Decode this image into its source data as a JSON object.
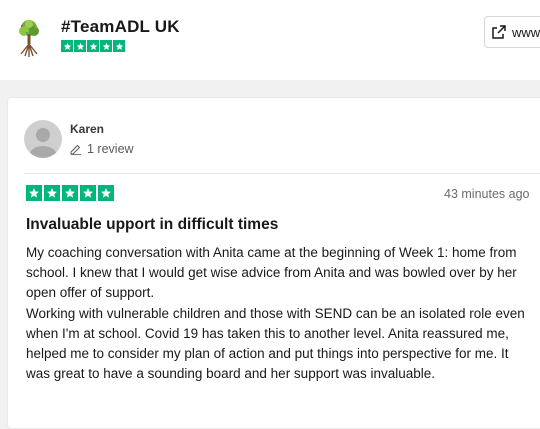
{
  "header": {
    "company_name": "#TeamADL UK",
    "rating_stars": 5,
    "website_button_label": "www",
    "brand_color": "#00b67a",
    "logo_icon": "tree-logo-icon",
    "external_link_icon": "external-link-icon"
  },
  "review": {
    "reviewer_name": "Karen",
    "review_count": "1 review",
    "rating_stars": 5,
    "date": "43 minutes ago",
    "title": "Invaluable upport in difficult times",
    "body_paragraphs": [
      "My coaching conversation with Anita came at the beginning of Week 1: home from school. I knew that I would get wise advice from Anita and was bowled over by her open offer of support.",
      "Working with vulnerable children and those with SEND can be an isolated role even when I'm at school. Covid 19 has taken this to another level. Anita reassured me, helped me to consider my plan of action and put things into perspective for me. It was great to have a sounding board and her support was invaluable."
    ]
  }
}
